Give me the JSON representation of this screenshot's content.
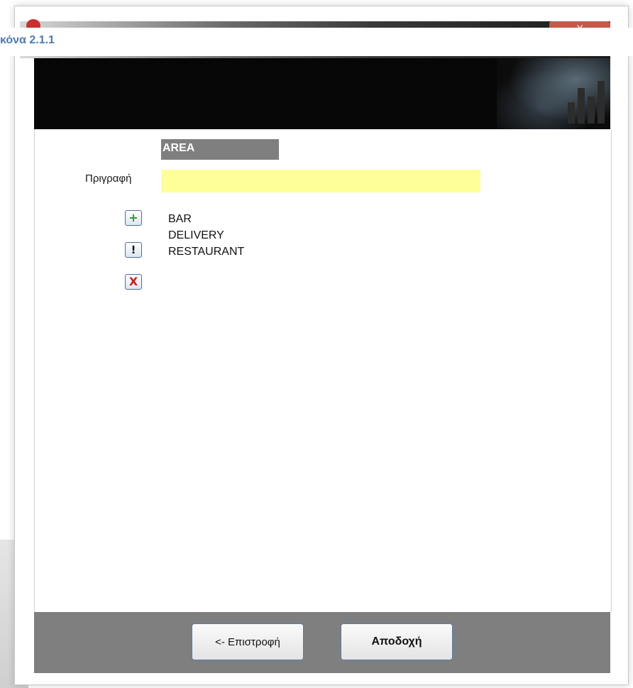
{
  "caption": "κόνα 2.1.1",
  "window": {
    "close_label": "X"
  },
  "form": {
    "area_title": "AREA",
    "description_label": "Πριγραφή",
    "description_value": ""
  },
  "icons": {
    "add": "+",
    "edit": "!",
    "delete": "X"
  },
  "list": {
    "items": [
      "BAR",
      "DELIVERY",
      "RESTAURANT"
    ]
  },
  "footer": {
    "back_label": "<- Επιστροφή",
    "accept_label": "Αποδοχή"
  },
  "colors": {
    "description_field": "#ffff99",
    "header_bg": "#7f7f7f",
    "add_icon": "#2a9a2a",
    "delete_icon": "#d01a1a"
  }
}
